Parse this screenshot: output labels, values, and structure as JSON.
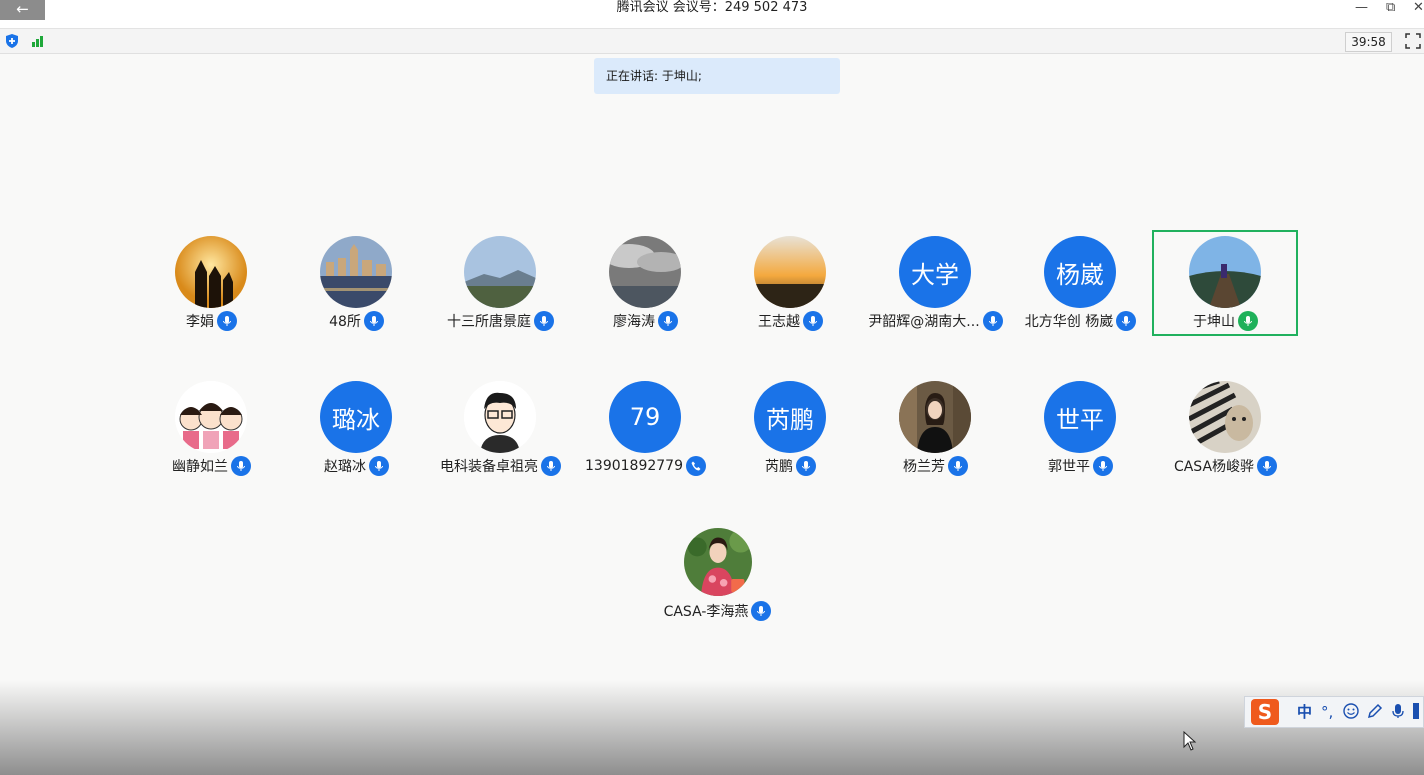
{
  "window": {
    "back_glyph": "←",
    "title": "腾讯会议 会议号：249 502 473",
    "minimize_glyph": "—",
    "restore_glyph": "⧉",
    "close_glyph": "✕"
  },
  "toolbar": {
    "timer": "39:58",
    "fullscreen_icon": "fullscreen-icon",
    "shield_icon": "security-shield-icon",
    "signal_icon": "network-signal-icon"
  },
  "speaking": {
    "text": "正在讲话: 于坤山;"
  },
  "colors": {
    "accent": "#1a73e8",
    "speaking_green": "#21b15e",
    "banner": "#dbeafb"
  },
  "participants": [
    {
      "name": "李娟",
      "avatar": "photo-sunset-family",
      "mic": "mic"
    },
    {
      "name": "48所",
      "avatar": "photo-lakeside-town",
      "mic": "mic"
    },
    {
      "name": "十三所唐景庭",
      "avatar": "photo-city-mountain",
      "mic": "mic"
    },
    {
      "name": "廖海涛",
      "avatar": "photo-cloudy-sea",
      "mic": "mic"
    },
    {
      "name": "王志越",
      "avatar": "photo-sunset-lake",
      "mic": "mic"
    },
    {
      "name": "尹韶辉@湖南大...",
      "avatar_text": "大学",
      "mic": "mic"
    },
    {
      "name": "北方华创 杨崴",
      "avatar_text": "杨崴",
      "mic": "mic"
    },
    {
      "name": "于坤山",
      "avatar": "photo-boardwalk",
      "mic": "mic-active"
    },
    {
      "name": "幽静如兰",
      "avatar": "cartoon-girls",
      "mic": "mic"
    },
    {
      "name": "赵璐冰",
      "avatar_text": "璐冰",
      "mic": "mic"
    },
    {
      "name": "电科装备卓祖亮",
      "avatar": "cartoon-man-glasses",
      "mic": "mic"
    },
    {
      "name": "13901892779",
      "avatar_text": "79",
      "mic": "phone"
    },
    {
      "name": "芮鹏",
      "avatar_text": "芮鹏",
      "mic": "mic"
    },
    {
      "name": "杨兰芳",
      "avatar": "photo-woman",
      "mic": "mic"
    },
    {
      "name": "郭世平",
      "avatar_text": "世平",
      "mic": "mic"
    },
    {
      "name": "CASA杨峻骅",
      "avatar": "photo-cat-stripes",
      "mic": "mic"
    },
    {
      "name": "CASA-李海燕",
      "avatar": "photo-woman-flowers",
      "mic": "mic"
    }
  ],
  "ime": {
    "logo": "S",
    "lang": "中",
    "punct": "°,",
    "emoji_icon": "smiley-icon",
    "pen_icon": "pen-icon",
    "voice_icon": "mic-icon"
  }
}
